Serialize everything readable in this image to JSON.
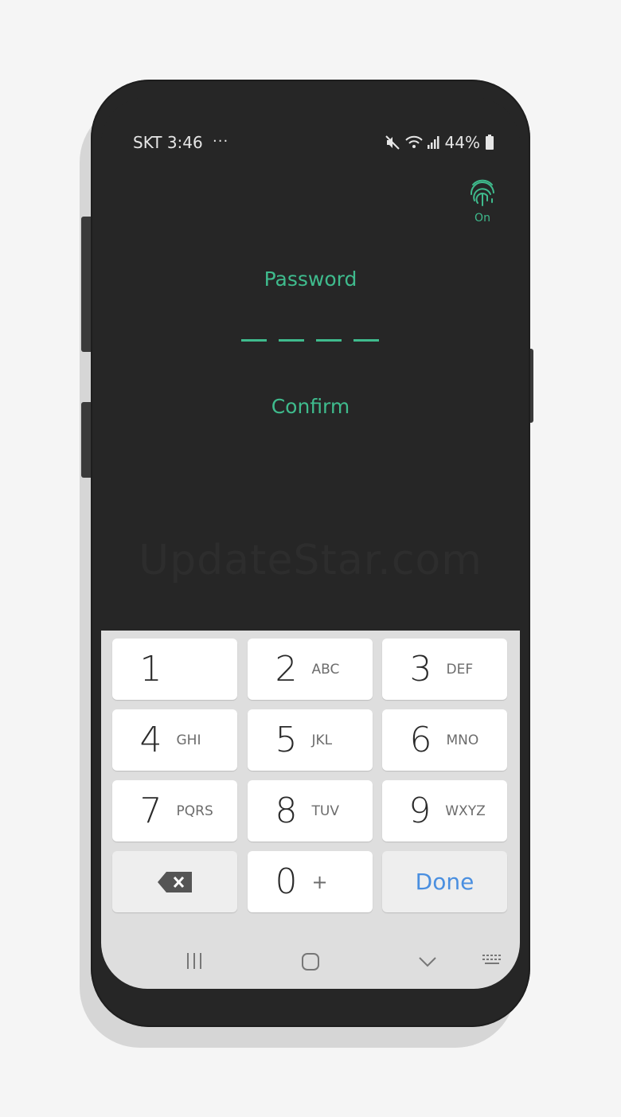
{
  "status_bar": {
    "carrier_time": "SKT 3:46",
    "more": "···",
    "battery": "44%",
    "icons": [
      "mute-icon",
      "wifi-icon",
      "signal-icon",
      "battery-icon"
    ]
  },
  "fingerprint": {
    "icon": "fingerprint-icon",
    "label": "On"
  },
  "form": {
    "password_label": "Password",
    "confirm_label": "Confirm",
    "pin_length": 4
  },
  "watermark": "UpdateStar.com",
  "keypad": {
    "keys": [
      {
        "num": "1",
        "letters": ""
      },
      {
        "num": "2",
        "letters": "ABC"
      },
      {
        "num": "3",
        "letters": "DEF"
      },
      {
        "num": "4",
        "letters": "GHI"
      },
      {
        "num": "5",
        "letters": "JKL"
      },
      {
        "num": "6",
        "letters": "MNO"
      },
      {
        "num": "7",
        "letters": "PQRS"
      },
      {
        "num": "8",
        "letters": "TUV"
      },
      {
        "num": "9",
        "letters": "WXYZ"
      },
      {
        "num": "0",
        "letters": "+"
      }
    ],
    "done_label": "Done",
    "backspace_icon": "backspace-icon"
  },
  "nav_bar": [
    "recent-apps-icon",
    "home-icon",
    "hide-keyboard-icon",
    "keyboard-switch-icon"
  ],
  "colors": {
    "accent": "#3fbb8d",
    "done": "#4a8fe0",
    "background": "#262626"
  }
}
